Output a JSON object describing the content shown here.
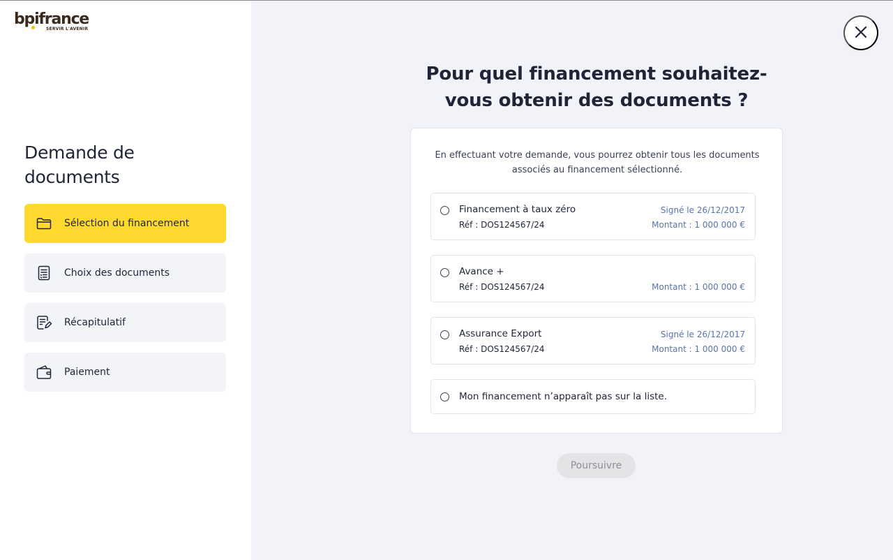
{
  "brand": {
    "name": "bpifrance",
    "tagline": "SERVIR L'AVENIR",
    "dot_color": "#f5c400"
  },
  "sidebar": {
    "title": "Demande de documents",
    "steps": [
      {
        "label": "Sélection du financement",
        "icon": "folder-icon",
        "active": true
      },
      {
        "label": "Choix des documents",
        "icon": "document-list-icon",
        "active": false
      },
      {
        "label": "Récapitulatif",
        "icon": "document-edit-icon",
        "active": false
      },
      {
        "label": "Paiement",
        "icon": "wallet-icon",
        "active": false
      }
    ],
    "active_color": "#ffd92e"
  },
  "main": {
    "close_icon": "close-icon",
    "title": "Pour quel financement souhaitez-vous obtenir des documents ?",
    "intro": "En effectuant votre demande, vous pourrez obtenir tous les documents associés au financement sélectionné.",
    "options": [
      {
        "name": "Financement à taux zéro",
        "ref": "Réf : DOS124567/24",
        "date": "Signé le 26/12/2017",
        "amount": "Montant : 1 000 000 €"
      },
      {
        "name": "Avance +",
        "ref": "Réf : DOS124567/24",
        "date": "",
        "amount": "Montant : 1 000 000 €"
      },
      {
        "name": "Assurance Export",
        "ref": "Réf : DOS124567/24",
        "date": "Signé le 26/12/2017",
        "amount": "Montant : 1 000 000 €"
      },
      {
        "name": "Mon financement n’apparaît pas sur la liste."
      }
    ],
    "submit_label": "Poursuivre"
  }
}
